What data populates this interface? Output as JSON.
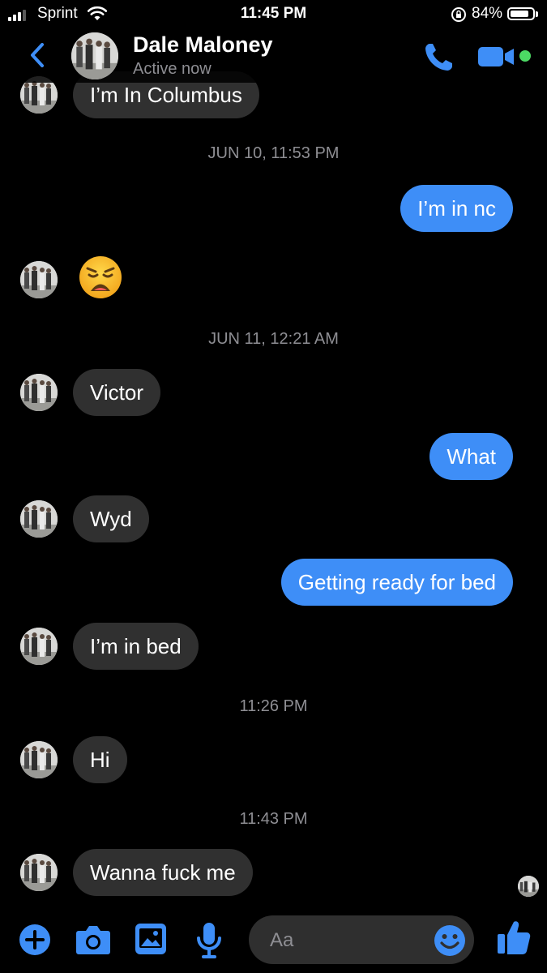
{
  "status_bar": {
    "carrier": "Sprint",
    "time": "11:45 PM",
    "battery_percent": "84%",
    "battery_level": 0.84,
    "signal_bars": 3
  },
  "header": {
    "contact_name": "Dale Maloney",
    "contact_status": "Active now",
    "icons": [
      "chevron-left-icon",
      "phone-icon",
      "video-camera-icon",
      "online-dot"
    ]
  },
  "colors": {
    "accent": "#3e8ef7",
    "incoming_bubble": "#303030",
    "background": "#000000",
    "online": "#4cd964",
    "timestamp": "#8e8e93"
  },
  "conversation": {
    "messages": [
      {
        "type": "in",
        "text": "I’m In Columbus"
      },
      {
        "type": "timestamp",
        "text": "JUN 10, 11:53 PM"
      },
      {
        "type": "out",
        "text": "I’m in nc"
      },
      {
        "type": "in-emoji",
        "emoji": "weary-face"
      },
      {
        "type": "timestamp",
        "text": "JUN 11, 12:21 AM"
      },
      {
        "type": "in",
        "text": "Victor"
      },
      {
        "type": "out",
        "text": "What"
      },
      {
        "type": "in",
        "text": "Wyd"
      },
      {
        "type": "out",
        "text": "Getting ready for bed"
      },
      {
        "type": "in",
        "text": "I’m in bed"
      },
      {
        "type": "timestamp",
        "text": "11:26 PM"
      },
      {
        "type": "in",
        "text": "Hi"
      },
      {
        "type": "timestamp",
        "text": "11:43 PM"
      },
      {
        "type": "in",
        "text": "Wanna fuck me"
      }
    ]
  },
  "composer": {
    "placeholder": "Aa",
    "icons": [
      "plus-icon",
      "camera-icon",
      "gallery-icon",
      "microphone-icon",
      "emoji-icon",
      "thumbs-up-icon"
    ]
  }
}
